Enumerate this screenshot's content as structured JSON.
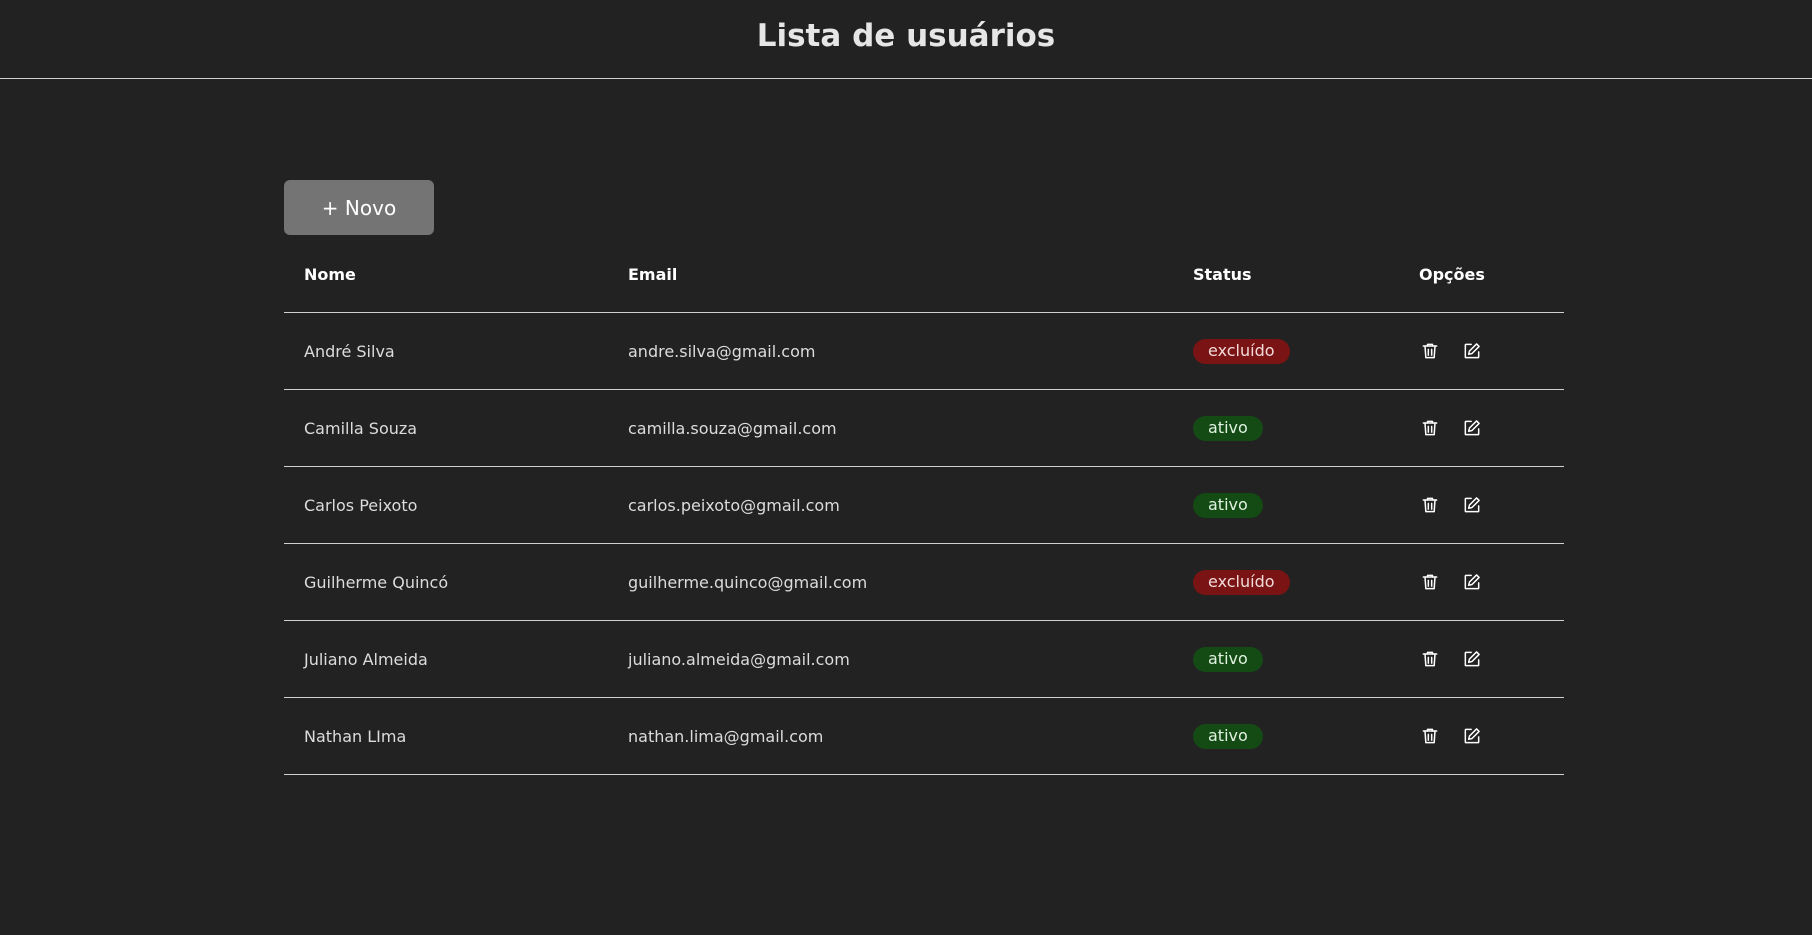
{
  "header": {
    "title": "Lista de usuários"
  },
  "toolbar": {
    "new_label": "+ Novo"
  },
  "table": {
    "columns": [
      "Nome",
      "Email",
      "Status",
      "Opções"
    ],
    "rows": [
      {
        "name": "André Silva",
        "email": "andre.silva@gmail.com",
        "status": "excluído",
        "status_kind": "excluido"
      },
      {
        "name": "Camilla Souza",
        "email": "camilla.souza@gmail.com",
        "status": "ativo",
        "status_kind": "ativo"
      },
      {
        "name": "Carlos Peixoto",
        "email": "carlos.peixoto@gmail.com",
        "status": "ativo",
        "status_kind": "ativo"
      },
      {
        "name": "Guilherme Quincó",
        "email": "guilherme.quinco@gmail.com",
        "status": "excluído",
        "status_kind": "excluido"
      },
      {
        "name": "Juliano Almeida",
        "email": "juliano.almeida@gmail.com",
        "status": "ativo",
        "status_kind": "ativo"
      },
      {
        "name": "Nathan LIma",
        "email": "nathan.lima@gmail.com",
        "status": "ativo",
        "status_kind": "ativo"
      }
    ],
    "row_actions": [
      "trash-icon",
      "edit-icon"
    ]
  },
  "colors": {
    "background": "#222222",
    "button": "#747474",
    "status_excluido": "#7a1414",
    "status_ativo": "#144a14",
    "divider": "#d0d0d0"
  }
}
